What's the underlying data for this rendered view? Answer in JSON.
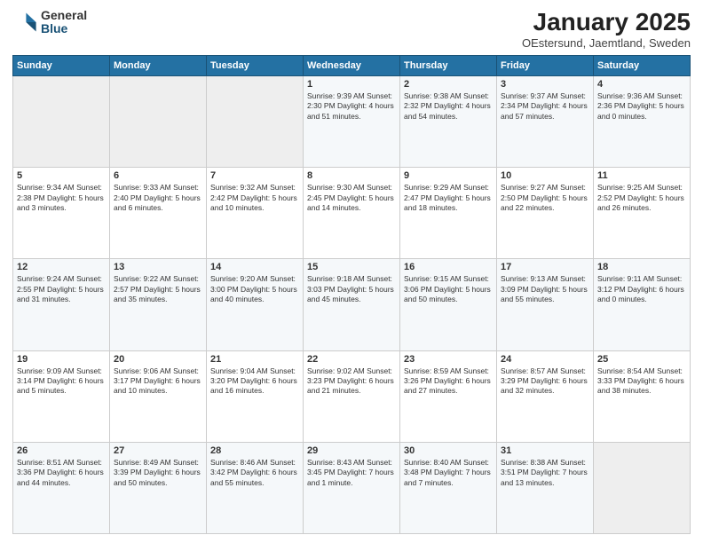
{
  "logo": {
    "general": "General",
    "blue": "Blue"
  },
  "title": "January 2025",
  "subtitle": "OEstersund, Jaemtland, Sweden",
  "days_header": [
    "Sunday",
    "Monday",
    "Tuesday",
    "Wednesday",
    "Thursday",
    "Friday",
    "Saturday"
  ],
  "weeks": [
    [
      {
        "num": "",
        "info": ""
      },
      {
        "num": "",
        "info": ""
      },
      {
        "num": "",
        "info": ""
      },
      {
        "num": "1",
        "info": "Sunrise: 9:39 AM\nSunset: 2:30 PM\nDaylight: 4 hours\nand 51 minutes."
      },
      {
        "num": "2",
        "info": "Sunrise: 9:38 AM\nSunset: 2:32 PM\nDaylight: 4 hours\nand 54 minutes."
      },
      {
        "num": "3",
        "info": "Sunrise: 9:37 AM\nSunset: 2:34 PM\nDaylight: 4 hours\nand 57 minutes."
      },
      {
        "num": "4",
        "info": "Sunrise: 9:36 AM\nSunset: 2:36 PM\nDaylight: 5 hours\nand 0 minutes."
      }
    ],
    [
      {
        "num": "5",
        "info": "Sunrise: 9:34 AM\nSunset: 2:38 PM\nDaylight: 5 hours\nand 3 minutes."
      },
      {
        "num": "6",
        "info": "Sunrise: 9:33 AM\nSunset: 2:40 PM\nDaylight: 5 hours\nand 6 minutes."
      },
      {
        "num": "7",
        "info": "Sunrise: 9:32 AM\nSunset: 2:42 PM\nDaylight: 5 hours\nand 10 minutes."
      },
      {
        "num": "8",
        "info": "Sunrise: 9:30 AM\nSunset: 2:45 PM\nDaylight: 5 hours\nand 14 minutes."
      },
      {
        "num": "9",
        "info": "Sunrise: 9:29 AM\nSunset: 2:47 PM\nDaylight: 5 hours\nand 18 minutes."
      },
      {
        "num": "10",
        "info": "Sunrise: 9:27 AM\nSunset: 2:50 PM\nDaylight: 5 hours\nand 22 minutes."
      },
      {
        "num": "11",
        "info": "Sunrise: 9:25 AM\nSunset: 2:52 PM\nDaylight: 5 hours\nand 26 minutes."
      }
    ],
    [
      {
        "num": "12",
        "info": "Sunrise: 9:24 AM\nSunset: 2:55 PM\nDaylight: 5 hours\nand 31 minutes."
      },
      {
        "num": "13",
        "info": "Sunrise: 9:22 AM\nSunset: 2:57 PM\nDaylight: 5 hours\nand 35 minutes."
      },
      {
        "num": "14",
        "info": "Sunrise: 9:20 AM\nSunset: 3:00 PM\nDaylight: 5 hours\nand 40 minutes."
      },
      {
        "num": "15",
        "info": "Sunrise: 9:18 AM\nSunset: 3:03 PM\nDaylight: 5 hours\nand 45 minutes."
      },
      {
        "num": "16",
        "info": "Sunrise: 9:15 AM\nSunset: 3:06 PM\nDaylight: 5 hours\nand 50 minutes."
      },
      {
        "num": "17",
        "info": "Sunrise: 9:13 AM\nSunset: 3:09 PM\nDaylight: 5 hours\nand 55 minutes."
      },
      {
        "num": "18",
        "info": "Sunrise: 9:11 AM\nSunset: 3:12 PM\nDaylight: 6 hours\nand 0 minutes."
      }
    ],
    [
      {
        "num": "19",
        "info": "Sunrise: 9:09 AM\nSunset: 3:14 PM\nDaylight: 6 hours\nand 5 minutes."
      },
      {
        "num": "20",
        "info": "Sunrise: 9:06 AM\nSunset: 3:17 PM\nDaylight: 6 hours\nand 10 minutes."
      },
      {
        "num": "21",
        "info": "Sunrise: 9:04 AM\nSunset: 3:20 PM\nDaylight: 6 hours\nand 16 minutes."
      },
      {
        "num": "22",
        "info": "Sunrise: 9:02 AM\nSunset: 3:23 PM\nDaylight: 6 hours\nand 21 minutes."
      },
      {
        "num": "23",
        "info": "Sunrise: 8:59 AM\nSunset: 3:26 PM\nDaylight: 6 hours\nand 27 minutes."
      },
      {
        "num": "24",
        "info": "Sunrise: 8:57 AM\nSunset: 3:29 PM\nDaylight: 6 hours\nand 32 minutes."
      },
      {
        "num": "25",
        "info": "Sunrise: 8:54 AM\nSunset: 3:33 PM\nDaylight: 6 hours\nand 38 minutes."
      }
    ],
    [
      {
        "num": "26",
        "info": "Sunrise: 8:51 AM\nSunset: 3:36 PM\nDaylight: 6 hours\nand 44 minutes."
      },
      {
        "num": "27",
        "info": "Sunrise: 8:49 AM\nSunset: 3:39 PM\nDaylight: 6 hours\nand 50 minutes."
      },
      {
        "num": "28",
        "info": "Sunrise: 8:46 AM\nSunset: 3:42 PM\nDaylight: 6 hours\nand 55 minutes."
      },
      {
        "num": "29",
        "info": "Sunrise: 8:43 AM\nSunset: 3:45 PM\nDaylight: 7 hours\nand 1 minute."
      },
      {
        "num": "30",
        "info": "Sunrise: 8:40 AM\nSunset: 3:48 PM\nDaylight: 7 hours\nand 7 minutes."
      },
      {
        "num": "31",
        "info": "Sunrise: 8:38 AM\nSunset: 3:51 PM\nDaylight: 7 hours\nand 13 minutes."
      },
      {
        "num": "",
        "info": ""
      }
    ]
  ]
}
